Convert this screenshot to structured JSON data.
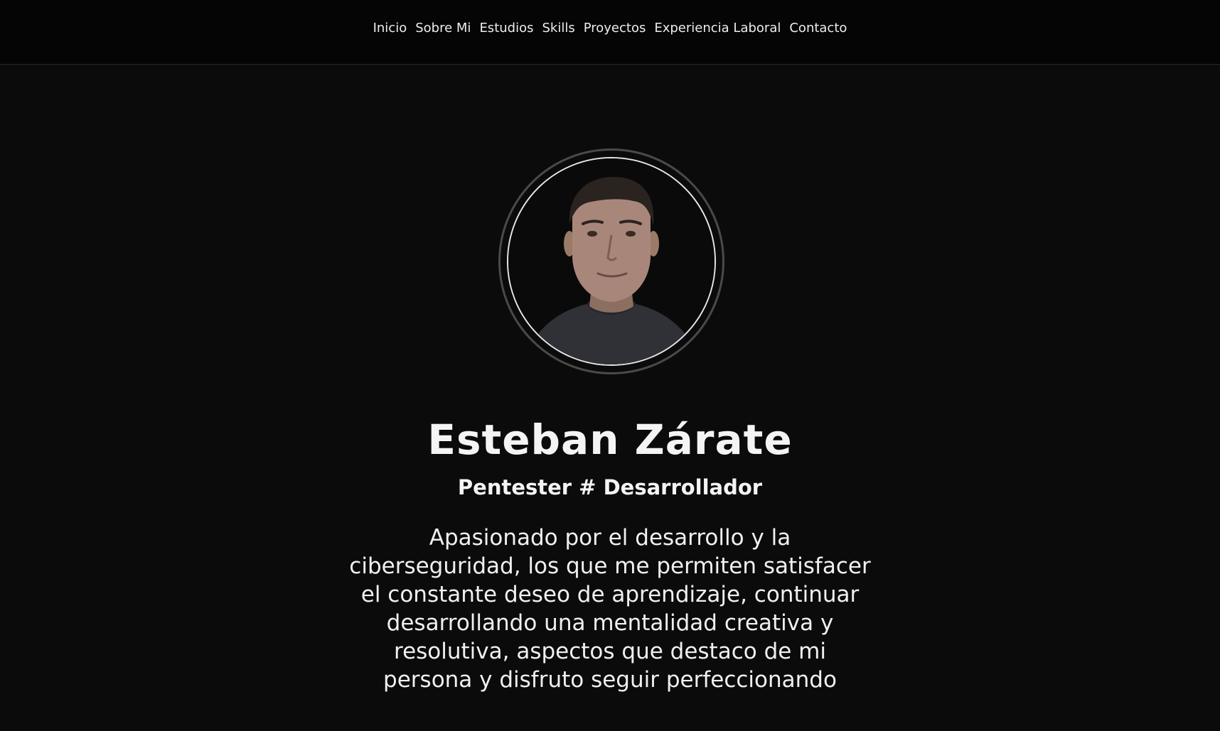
{
  "nav": {
    "items": [
      {
        "label": "Inicio"
      },
      {
        "label": "Sobre Mi"
      },
      {
        "label": "Estudios"
      },
      {
        "label": "Skills"
      },
      {
        "label": "Proyectos"
      },
      {
        "label": "Experiencia Laboral"
      },
      {
        "label": "Contacto"
      }
    ]
  },
  "hero": {
    "name": "Esteban Zárate",
    "role": "Pentester # Desarrollador",
    "bio": "Apasionado por el desarrollo y la ciberseguridad, los que me permiten satisfacer el constante deseo de aprendizaje, continuar desarrollando una mentalidad creativa y resolutiva, aspectos que destaco de mi persona y disfruto seguir perfeccionando"
  },
  "colors": {
    "background": "#0b0b0b",
    "navbar": "#050505",
    "text": "#f2f2f2"
  }
}
